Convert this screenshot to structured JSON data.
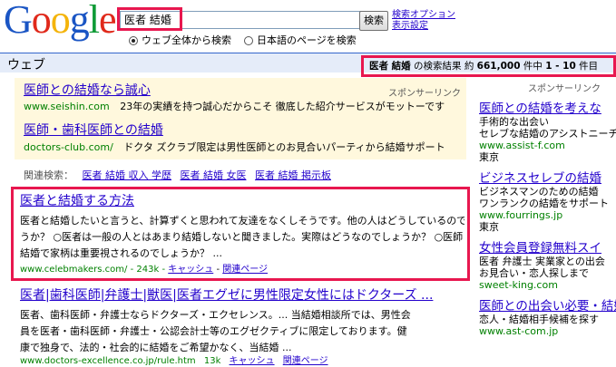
{
  "header": {
    "logo_letters": [
      "G",
      "o",
      "o",
      "g",
      "l",
      "e"
    ],
    "logo_colors": [
      "#1a55c4",
      "#e0291b",
      "#f4b40b",
      "#1a55c4",
      "#0e9a35",
      "#e0291b"
    ],
    "search_value": "医者 結婚",
    "search_button": "検索",
    "option_link_1": "検索オプション",
    "option_link_2": "表示設定",
    "radio_all": "ウェブ全体から検索",
    "radio_lang": "日本語のページを検索"
  },
  "bar": {
    "label": "ウェブ",
    "stats_prefix_bold": "医者 結婚",
    "stats_text": " の検索結果 約 ",
    "stats_count": "661,000",
    "stats_mid": " 件中 ",
    "stats_range": "1 - 10",
    "stats_suffix": " 件目"
  },
  "ads_top": {
    "sponsor_label": "スポンサーリンク",
    "ad1_title": "医師との結婚なら誠心",
    "ad1_url": "www.seishin.com",
    "ad1_desc": "23年の実績を持つ誠心だからこそ 徹底した紹介サービスがモットーです",
    "ad2_title": "医師・歯科医師との結婚",
    "ad2_url": "doctors-club.com/",
    "ad2_desc": "ドクタ ズクラブ限定は男性医師とのお見合いパーティから結婚サポート"
  },
  "related": {
    "label": "関連検索：",
    "items": [
      "医者 結婚 収入 学歴",
      "医者 結婚 女医",
      "医者 結婚 掲示板"
    ]
  },
  "result1": {
    "title": "医者と結婚する方法",
    "snippet_1": "医者と結婚したいと言うと、計算ずくと思われて友達をなくしそうです。他の人はどうしているのでしょ",
    "snippet_2": "うか？ ○医者は一般の人とはあまり結婚しないと聞きました。実際はどうなのでしょうか？ ○医師との",
    "snippet_3": "結婚で家柄は重要視されるのでしょうか？ ...",
    "url": "www.celebmakers.com/",
    "size": "- 243k -",
    "cache": "キャッシュ",
    "similar": "関連ページ"
  },
  "result2": {
    "title": "医者|歯科医師|弁護士|獣医|医者エグゼに男性限定女性にはドクターズ ...",
    "snippet_1": "医者、歯科医師・弁護士ならドクターズ・エクセレンス。... 当結婚相談所では、男性会",
    "snippet_2": "員を医者・歯科医師・弁護士・公認会計士等のエグゼクティブに限定しております。健",
    "snippet_3": "康で独身で、法的・社会的に結婚をご希望かなく、当結婚 ...",
    "url": "www.doctors-excellence.co.jp/rule.htm",
    "size": "13k",
    "cache": "キャッシュ",
    "similar": "関連ページ"
  },
  "right_ads": {
    "sponsor_label": "スポンサーリンク",
    "items": [
      {
        "title": "医師との結婚を考えな",
        "line1": "手術的な出会い",
        "line2": "セレブな結婚のアシストニーチ",
        "url": "www.assist-f.com",
        "loc": "東京"
      },
      {
        "title": "ビジネスセレブの結婚",
        "line1": "ビジネスマンのための結婚",
        "line2": "ワンランクの結婚をサポート",
        "url": "www.fourrings.jp",
        "loc": "東京"
      },
      {
        "title": "女性会員登録無料スイ",
        "line1": "医者 弁護士 実業家との出会",
        "line2": "お見合い・恋人探しまで",
        "url": "sweet-king.com",
        "loc": ""
      },
      {
        "title": "医師との出会い必要・結婚",
        "line1": "恋人・結婚相手候補を探す",
        "line2": "www.ast-com.jp",
        "url": "",
        "loc": ""
      }
    ]
  }
}
